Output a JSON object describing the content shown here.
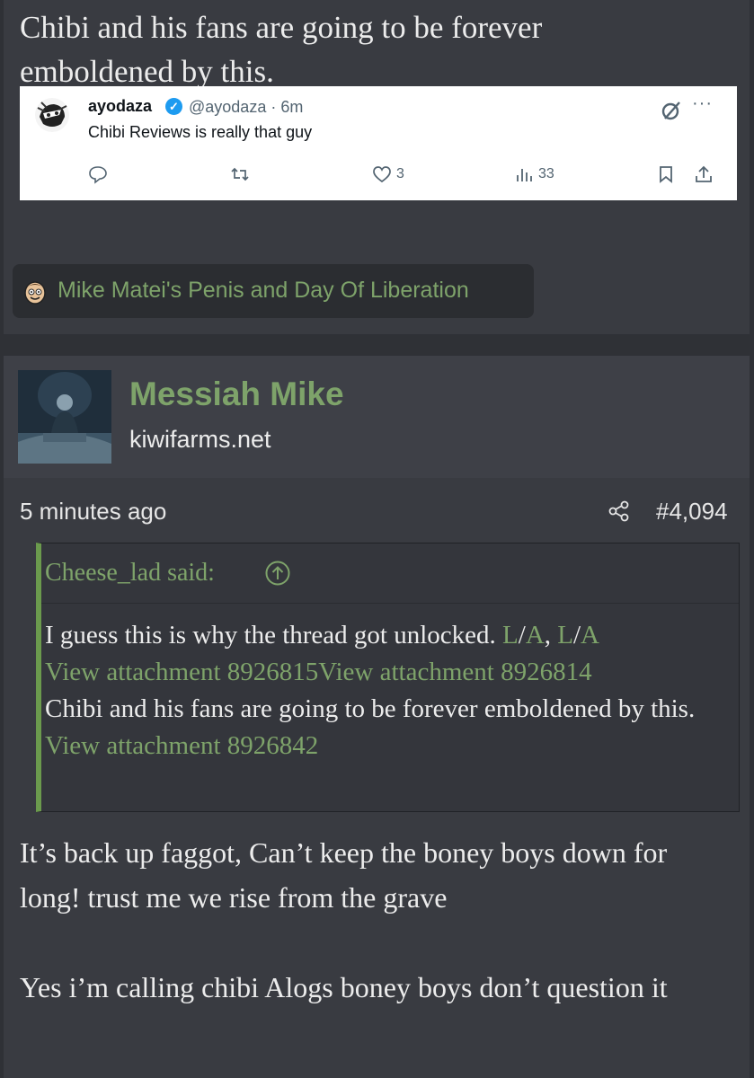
{
  "top_post": {
    "text_line1": "Chibi and his fans are going to be forever",
    "text_line2": "emboldened by this.",
    "tweet": {
      "name": "ayodaza",
      "verified_mark": "✓",
      "handle_time": "@ayodaza · 6m",
      "more": "···",
      "body": "Chibi Reviews is really that guy",
      "likes": "3",
      "views": "33",
      "icons": [
        "reply-icon",
        "retweet-icon",
        "heart-icon",
        "views-icon",
        "bookmark-icon",
        "share-icon",
        "grok-icon",
        "more-icon"
      ]
    },
    "tag_chip": {
      "label": "Mike Matei's Penis and Day Of Liberation"
    }
  },
  "main_post": {
    "user": {
      "name": "Messiah Mike",
      "site": "kiwifarms.net"
    },
    "time": "5 minutes ago",
    "post_number": "#4,094",
    "quote": {
      "author": "Cheese_lad said:",
      "line1_text": "I guess this is why the thread got unlocked. ",
      "la1_l": "L",
      "la1_a": "A",
      "la2_l": "L",
      "la2_a": "A",
      "slash": "/",
      "comma": ", ",
      "attach1": "View attachment 8926815",
      "attach2": "View attachment 8926814",
      "line3": "Chibi and his fans are going to be forever emboldened by this.",
      "attach3": "View attachment 8926842"
    },
    "reply_para1": "It’s back up faggot, Can’t keep the boney boys down for long! trust me we rise from the grave",
    "reply_para2": "Yes i’m calling chibi Alogs boney boys don’t question it"
  },
  "colors": {
    "page_bg": "#2f3136",
    "post_bg": "#393b41",
    "accent_green": "#7ea36a",
    "quote_border": "#6b9a4d",
    "tweet_bg": "#ffffff",
    "verified_blue": "#1d9bf0"
  }
}
